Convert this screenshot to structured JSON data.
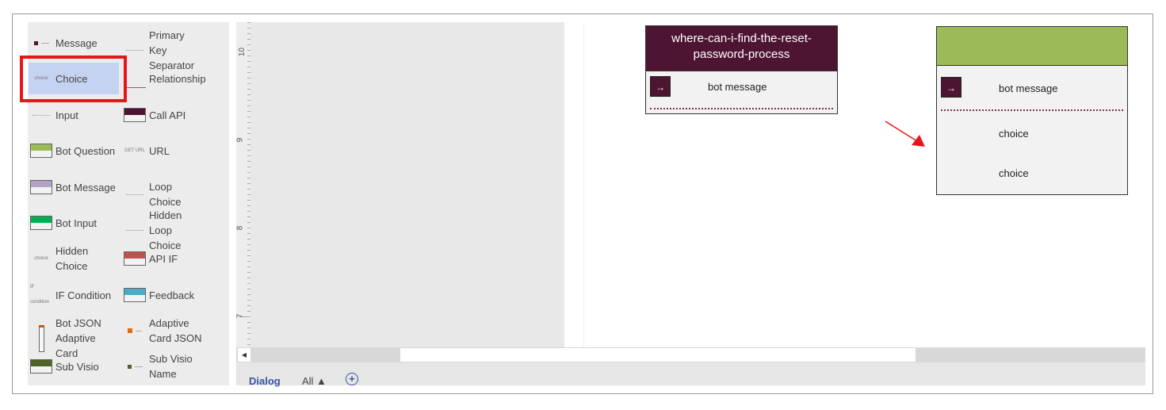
{
  "sidebar": {
    "items": [
      {
        "label": "Message",
        "icon": "message-icon"
      },
      {
        "label": "Primary Key Separator",
        "icon": "separator-icon"
      },
      {
        "label": "Choice",
        "icon": "choice-icon",
        "icon_text": "choice",
        "selected": true
      },
      {
        "label": "Relationship",
        "icon": "relationship-icon"
      },
      {
        "label": "Input",
        "icon": "input-icon"
      },
      {
        "label": "Call API",
        "icon": "call-api-icon",
        "color": "#4e1532"
      },
      {
        "label": "Bot Question",
        "icon": "bot-question-icon",
        "color": "#9bbb59"
      },
      {
        "label": "URL",
        "icon": "url-icon",
        "icon_text": "GET URL"
      },
      {
        "label": "Bot Message",
        "icon": "bot-message-icon",
        "color": "#b3a2c7"
      },
      {
        "label": "Loop Choice",
        "icon": "loop-choice-icon"
      },
      {
        "label": "Bot Input",
        "icon": "bot-input-icon",
        "color": "#00b050"
      },
      {
        "label": "Hidden Loop Choice",
        "icon": "hidden-loop-choice-icon"
      },
      {
        "label": "Hidden Choice",
        "icon": "hidden-choice-icon",
        "icon_text": "choice"
      },
      {
        "label": "API IF",
        "icon": "api-if-icon",
        "color": "#c0504d"
      },
      {
        "label": "IF Condition",
        "icon": "if-condition-icon",
        "icon_text": "IF condition"
      },
      {
        "label": "Feedback",
        "icon": "feedback-icon",
        "color": "#4bacc6"
      },
      {
        "label": "Bot JSON Adaptive Card",
        "icon": "bot-json-icon"
      },
      {
        "label": "Adaptive Card JSON",
        "icon": "adaptive-card-json-icon",
        "color": "#e46c0a"
      },
      {
        "label": "Sub Visio",
        "icon": "sub-visio-icon",
        "color": "#4f6228"
      },
      {
        "label": "Sub Visio Name",
        "icon": "sub-visio-name-icon"
      }
    ]
  },
  "ruler": {
    "labels": [
      "10",
      "9",
      "8",
      "7"
    ]
  },
  "tabs": [
    {
      "label": "Dialog",
      "active": true
    },
    {
      "label": "All ▲"
    },
    {
      "label": "+",
      "icon": "add-page-icon"
    }
  ],
  "canvas": {
    "card1": {
      "title": "where-can-i-find-the-reset-password-process",
      "row": "bot message",
      "header_color": "#4e1532"
    },
    "card2": {
      "header_color": "#9bbb59",
      "row": "bot message",
      "choices": [
        "choice",
        "choice"
      ]
    }
  },
  "colors": {
    "highlight": "#e8141a",
    "selection": "#c5d3f3",
    "link": "#3955a3"
  }
}
